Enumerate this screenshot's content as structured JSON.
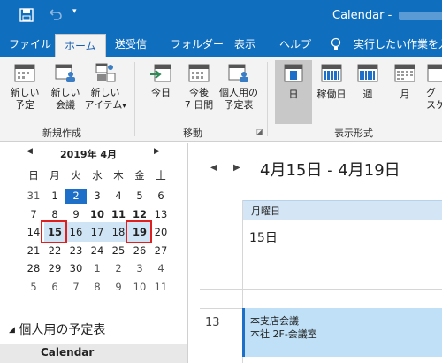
{
  "titlebar": {
    "title": "Calendar - ",
    "undo_icon": "undo-icon",
    "save_icon": "save-icon",
    "customize_icon": "dropdown-caret-icon"
  },
  "tabs": [
    {
      "label": "ファイル"
    },
    {
      "label": "ホーム"
    },
    {
      "label": "送受信"
    },
    {
      "label": "フォルダー"
    },
    {
      "label": "表示"
    },
    {
      "label": "ヘルプ"
    },
    {
      "label": "実行したい作業を入"
    }
  ],
  "ribbon": {
    "new_appointment": "新しい\n予定",
    "new_meeting": "新しい\n会議",
    "new_items": "新しい\nアイテム",
    "group_new": "新規作成",
    "today": "今日",
    "next7": "今後\n7 日間",
    "personal_cal": "個人用の\n予定表",
    "group_move": "移動",
    "day": "日",
    "workweek": "稼働日",
    "week": "週",
    "month": "月",
    "group_view": "表示形式",
    "more_label_top": "グ",
    "more_label_bottom": "スケ"
  },
  "mini_calendar": {
    "title": "2019年 4月",
    "weekdays": [
      "日",
      "月",
      "火",
      "水",
      "木",
      "金",
      "土"
    ],
    "rows": [
      [
        "31",
        "1",
        "2",
        "3",
        "4",
        "5",
        "6"
      ],
      [
        "7",
        "8",
        "9",
        "10",
        "11",
        "12",
        "13"
      ],
      [
        "14",
        "15",
        "16",
        "17",
        "18",
        "19",
        "20"
      ],
      [
        "21",
        "22",
        "23",
        "24",
        "25",
        "26",
        "27"
      ],
      [
        "28",
        "29",
        "30",
        "1",
        "2",
        "3",
        "4"
      ],
      [
        "5",
        "6",
        "7",
        "8",
        "9",
        "10",
        "11"
      ]
    ],
    "today": "2"
  },
  "left_panel": {
    "section_title": "個人用の予定表",
    "calendar_item": "Calendar"
  },
  "main": {
    "date_range": "4月15日 - 4月19日",
    "weekday_label": "月曜日",
    "day_number": "15日",
    "hour_label": "13",
    "appointment": {
      "title": "本支店会議",
      "location": "本社 2F-会議室"
    }
  },
  "colors": {
    "accent": "#106ebe",
    "highlight_red": "#e0201e",
    "appointment_bg": "#bfe0f7"
  }
}
